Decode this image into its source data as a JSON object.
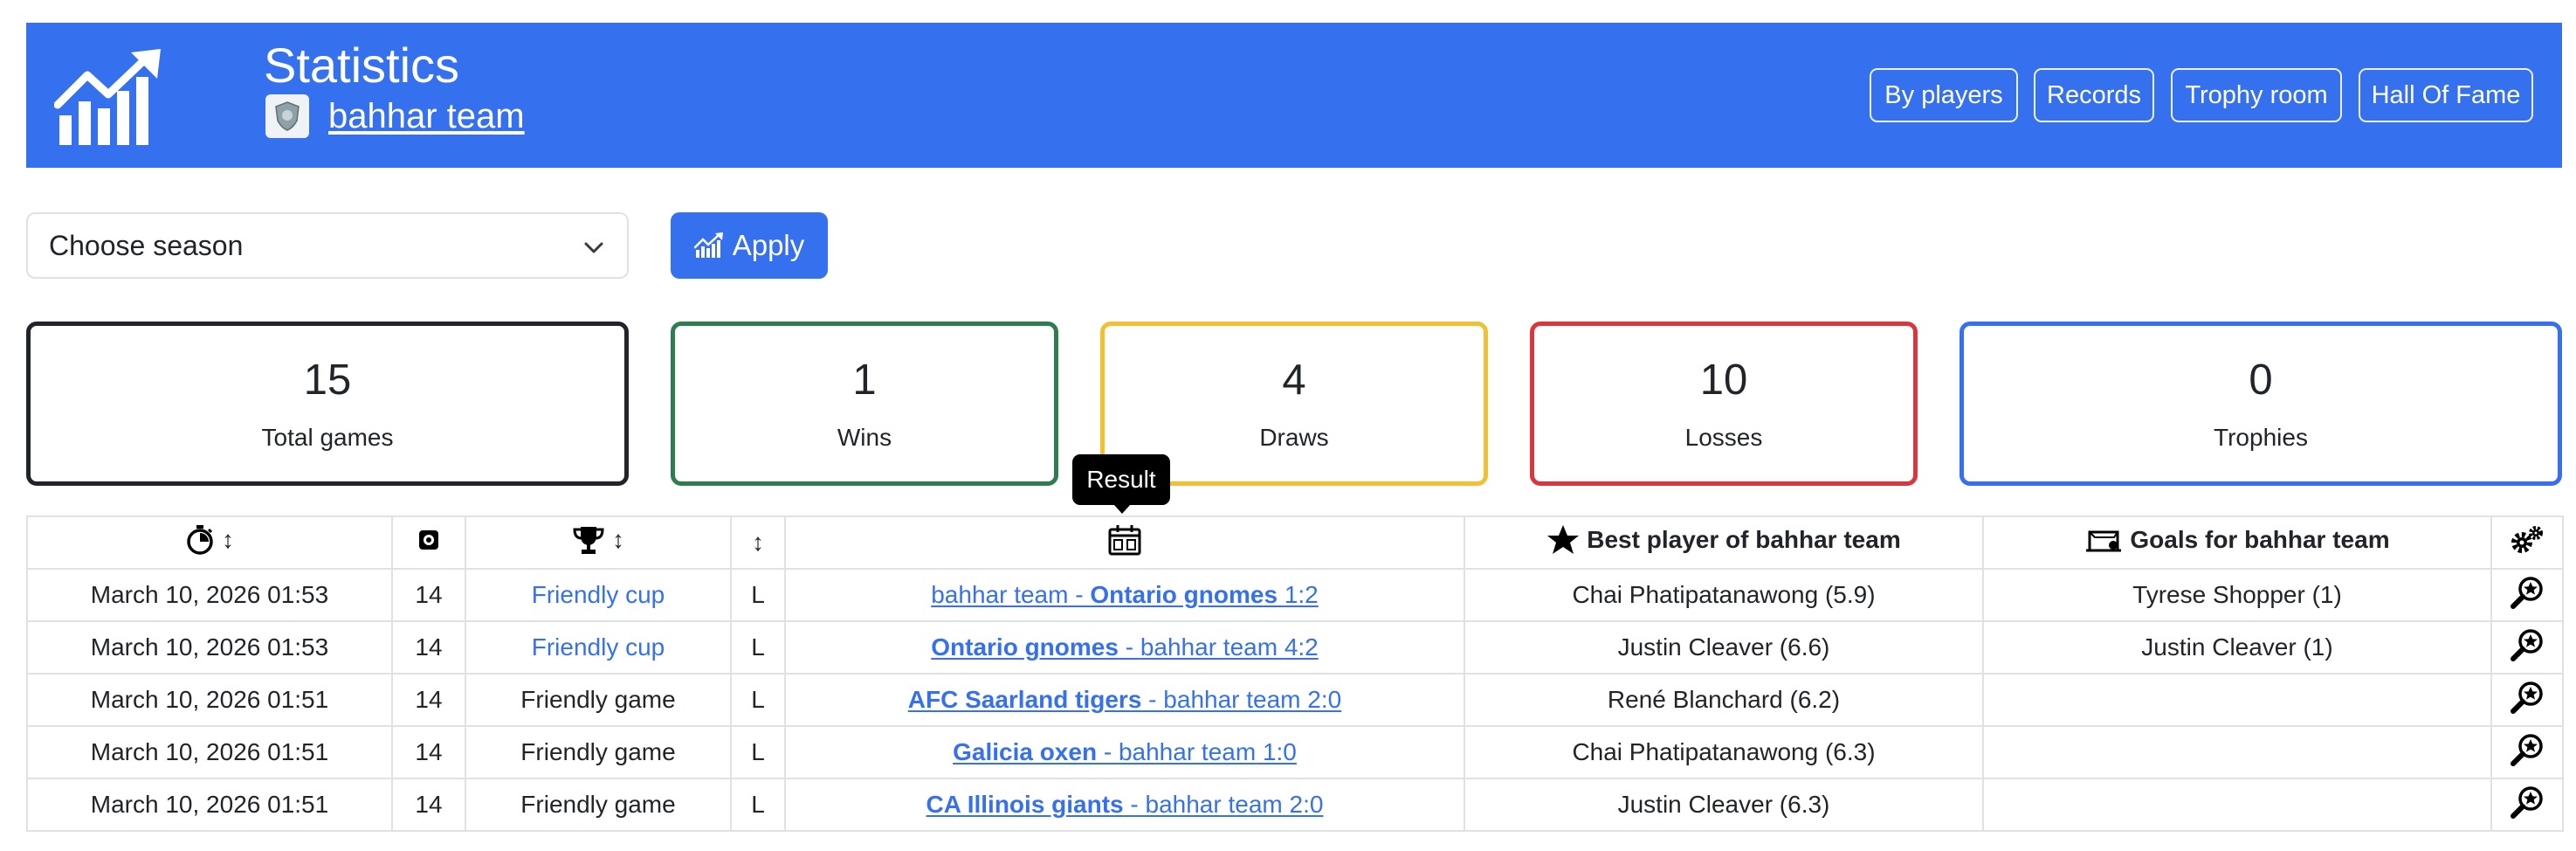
{
  "header": {
    "title": "Statistics",
    "team_name": "bahhar team",
    "buttons": [
      "By players",
      "Records",
      "Trophy room",
      "Hall Of Fame"
    ]
  },
  "filters": {
    "season_placeholder": "Choose season",
    "apply_label": "Apply"
  },
  "stats": [
    {
      "value": "15",
      "label": "Total games",
      "color": "#212529"
    },
    {
      "value": "1",
      "label": "Wins",
      "color": "#2e7d4f"
    },
    {
      "value": "4",
      "label": "Draws",
      "color": "#f2c033"
    },
    {
      "value": "10",
      "label": "Losses",
      "color": "#d9363e"
    },
    {
      "value": "0",
      "label": "Trophies",
      "color": "#3571ef"
    }
  ],
  "tooltip": "Result",
  "table": {
    "headers": {
      "best_player": "Best player of bahhar team",
      "goals": "Goals for bahhar team",
      "sort_glyph": "↕"
    },
    "rows": [
      {
        "date": "March 10, 2026 01:53",
        "season": "14",
        "competition": "Friendly cup",
        "competition_link": true,
        "result": "L",
        "home": "bahhar team",
        "away": "Ontario gnomes",
        "bold": "away",
        "score": "1:2",
        "best_player": "Chai Phatipatanawong (5.9)",
        "goals": "Tyrese Shopper (1)"
      },
      {
        "date": "March 10, 2026 01:53",
        "season": "14",
        "competition": "Friendly cup",
        "competition_link": true,
        "result": "L",
        "home": "Ontario gnomes",
        "away": "bahhar team",
        "bold": "home",
        "score": "4:2",
        "best_player": "Justin Cleaver (6.6)",
        "goals": "Justin Cleaver (1)"
      },
      {
        "date": "March 10, 2026 01:51",
        "season": "14",
        "competition": "Friendly game",
        "competition_link": false,
        "result": "L",
        "home": "AFC Saarland tigers",
        "away": "bahhar team",
        "bold": "home",
        "score": "2:0",
        "best_player": "René Blanchard (6.2)",
        "goals": ""
      },
      {
        "date": "March 10, 2026 01:51",
        "season": "14",
        "competition": "Friendly game",
        "competition_link": false,
        "result": "L",
        "home": "Galicia oxen",
        "away": "bahhar team",
        "bold": "home",
        "score": "1:0",
        "best_player": "Chai Phatipatanawong (6.3)",
        "goals": ""
      },
      {
        "date": "March 10, 2026 01:51",
        "season": "14",
        "competition": "Friendly game",
        "competition_link": false,
        "result": "L",
        "home": "CA Illinois giants",
        "away": "bahhar team",
        "bold": "home",
        "score": "2:0",
        "best_player": "Justin Cleaver (6.3)",
        "goals": ""
      }
    ]
  }
}
